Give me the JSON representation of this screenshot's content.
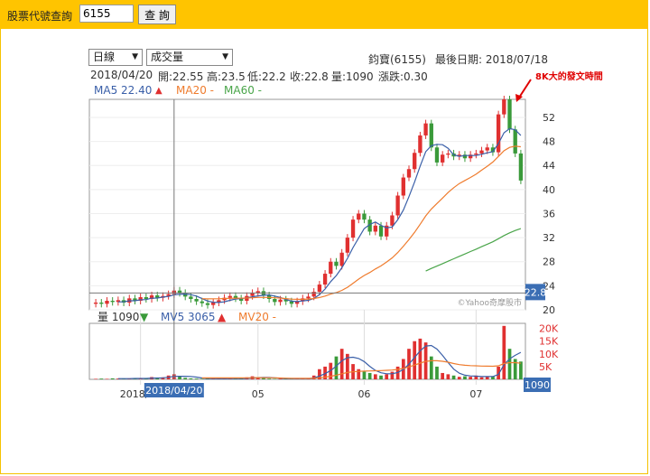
{
  "query": {
    "label": "股票代號查詢",
    "input_value": "6155",
    "button_label": "查 詢"
  },
  "controls": {
    "period_select": "日線",
    "indicator_select": "成交量"
  },
  "header": {
    "stock": "鈞寶(6155)",
    "last_date": "最後日期: 2018/07/18"
  },
  "ohlc": {
    "date": "2018/04/20",
    "open": "開:22.55",
    "high": "高:23.5",
    "low": "低:22.2",
    "close": "收:22.8",
    "volume": "量:1090",
    "change": "漲跌:0.30"
  },
  "ma_legend": {
    "ma5": "MA5 22.40",
    "ma20": "MA20 -",
    "ma60": "MA60 -",
    "ma5_color": "#3a5fa8",
    "ma20_color": "#ef7c2e",
    "ma60_color": "#4aa54a",
    "ma5_arrow": "▲"
  },
  "annotation": "8K大的發文時間",
  "watermark": "©Yahoo奇摩股市",
  "price_axis": {
    "ticks": [
      "52",
      "48",
      "44",
      "40",
      "36",
      "32",
      "28",
      "24",
      "20"
    ],
    "current": "22.8"
  },
  "volume_legend": {
    "vol": "量 1090",
    "mv5": "MV5 3065",
    "mv20": "MV20 -",
    "vol_arrow": "▼",
    "mv5_arrow": "▲"
  },
  "volume_axis": {
    "ticks": [
      "20K",
      "15K",
      "10K",
      "5K"
    ],
    "current": "1090"
  },
  "x_axis": {
    "labels": [
      "2018/04",
      "05",
      "06",
      "07"
    ],
    "cursor_label": "2018/04/20"
  },
  "colors": {
    "up": "#e03030",
    "down": "#3a9a3a",
    "brand": "#ffc400",
    "price_tag": "#3b6eb4"
  },
  "chart_data": {
    "type": "candlestick",
    "price_ylim": [
      20,
      55
    ],
    "volume_ylim": [
      0,
      22000
    ],
    "closes": [
      21.2,
      21.0,
      21.5,
      21.3,
      21.6,
      21.2,
      21.9,
      21.5,
      22.1,
      21.8,
      22.4,
      22.0,
      22.3,
      22.6,
      23.2,
      22.8,
      22.2,
      21.8,
      21.4,
      21.1,
      20.8,
      21.2,
      21.6,
      22.0,
      22.3,
      21.9,
      21.5,
      22.3,
      22.8,
      23.1,
      22.4,
      21.8,
      21.3,
      21.7,
      21.4,
      21.0,
      21.4,
      21.9,
      22.2,
      23.0,
      24.2,
      26.0,
      28.0,
      27.3,
      29.5,
      32.0,
      35.0,
      36.0,
      35.0,
      33.0,
      34.0,
      32.2,
      34.0,
      35.7,
      39.0,
      42.0,
      43.4,
      46.1,
      49.0,
      51.0,
      47.0,
      44.5,
      45.8,
      46.0,
      45.5,
      45.8,
      45.2,
      45.8,
      46.0,
      46.5,
      47.0,
      46.2,
      52.5,
      55.0,
      50.0,
      46.0,
      41.5
    ],
    "volume_k": [
      0.2,
      0.3,
      0.2,
      0.4,
      0.3,
      0.2,
      0.3,
      0.5,
      0.4,
      0.3,
      0.9,
      0.6,
      0.8,
      1.5,
      2.0,
      1.2,
      0.6,
      0.4,
      0.3,
      0.2,
      0.2,
      0.3,
      0.2,
      0.4,
      0.3,
      0.2,
      0.3,
      0.8,
      1.2,
      0.9,
      0.5,
      0.3,
      0.2,
      0.3,
      0.2,
      0.2,
      0.3,
      0.4,
      0.3,
      1.5,
      4.0,
      5.0,
      6.5,
      9.0,
      12.0,
      10.0,
      6.0,
      4.0,
      3.0,
      2.5,
      2.0,
      1.5,
      2.0,
      3.0,
      5.0,
      8.0,
      12.0,
      15.0,
      16.0,
      14.5,
      9.0,
      5.0,
      2.5,
      2.0,
      1.5,
      1.0,
      1.2,
      1.0,
      1.5,
      0.8,
      1.0,
      1.2,
      5.0,
      21.0,
      12.0,
      8.0,
      7.0
    ],
    "volume_up": [
      1,
      0,
      1,
      0,
      1,
      0,
      1,
      0,
      1,
      0,
      1,
      0,
      1,
      1,
      1,
      0,
      0,
      0,
      0,
      0,
      0,
      1,
      1,
      1,
      1,
      0,
      0,
      1,
      1,
      1,
      0,
      0,
      0,
      1,
      0,
      0,
      1,
      1,
      1,
      1,
      1,
      1,
      1,
      0,
      1,
      1,
      1,
      1,
      0,
      0,
      1,
      0,
      1,
      1,
      1,
      1,
      1,
      1,
      1,
      1,
      0,
      0,
      1,
      1,
      0,
      1,
      0,
      1,
      1,
      1,
      1,
      0,
      1,
      1,
      0,
      0,
      0
    ]
  }
}
